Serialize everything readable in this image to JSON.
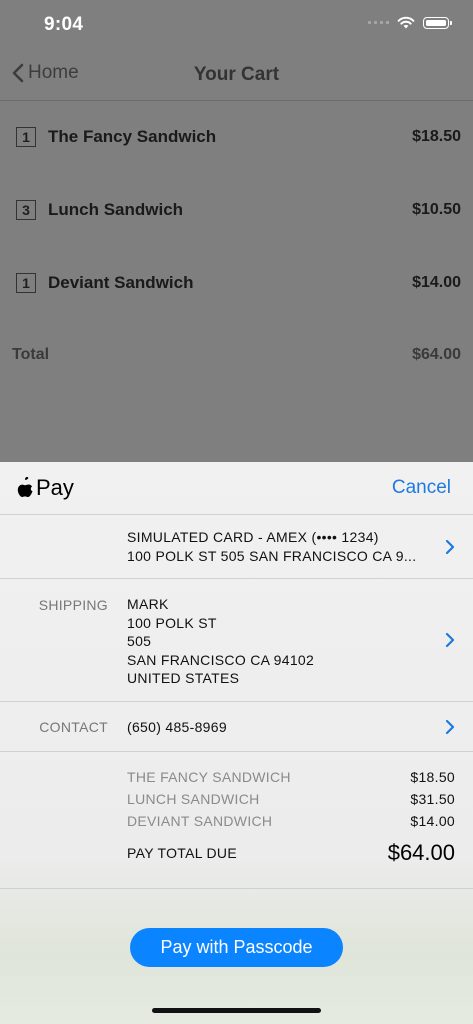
{
  "status_bar": {
    "time": "9:04"
  },
  "nav": {
    "back_label": "Home",
    "title": "Your Cart"
  },
  "cart": {
    "items": [
      {
        "qty": "1",
        "name": "The Fancy Sandwich",
        "price": "$18.50"
      },
      {
        "qty": "3",
        "name": "Lunch Sandwich",
        "price": "$10.50"
      },
      {
        "qty": "1",
        "name": "Deviant Sandwich",
        "price": "$14.00"
      }
    ],
    "total_label": "Total",
    "total_value": "$64.00"
  },
  "apple_pay": {
    "brand": "Pay",
    "cancel_label": "Cancel",
    "card": {
      "line1": "SIMULATED CARD - AMEX (•••• 1234)",
      "line2": "100 POLK ST 505 SAN FRANCISCO CA 9..."
    },
    "shipping": {
      "label": "SHIPPING",
      "lines": [
        "MARK",
        "100 POLK ST",
        "505",
        "SAN FRANCISCO CA 94102",
        "UNITED STATES"
      ]
    },
    "contact": {
      "label": "CONTACT",
      "value": "(650) 485-8969"
    },
    "summary": [
      {
        "name": "THE FANCY SANDWICH",
        "value": "$18.50"
      },
      {
        "name": "LUNCH SANDWICH",
        "value": "$31.50"
      },
      {
        "name": "DEVIANT SANDWICH",
        "value": "$14.00"
      }
    ],
    "due_label": "PAY TOTAL DUE",
    "due_amount": "$64.00",
    "pay_button_label": "Pay with Passcode"
  },
  "colors": {
    "accent": "#1f7ae0",
    "pay_button": "#0a84ff"
  }
}
